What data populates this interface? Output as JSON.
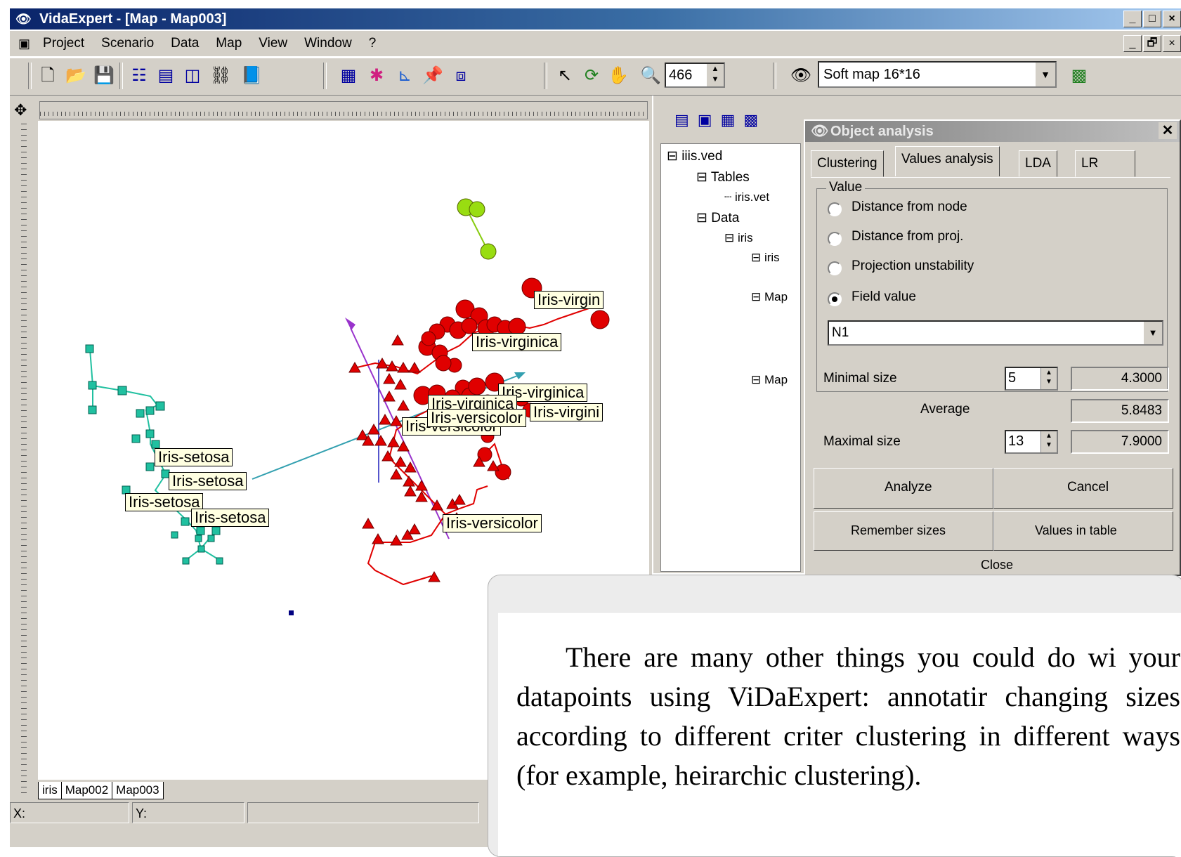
{
  "window": {
    "title": "VidaExpert - [Map - Map003]",
    "buttons": [
      "_",
      "□",
      "×"
    ],
    "mdi_buttons": [
      "_",
      "🗗",
      "×"
    ]
  },
  "menu": [
    "Project",
    "Scenario",
    "Data",
    "Map",
    "View",
    "Window",
    "?"
  ],
  "toolbar": {
    "zoom_value": "466",
    "map_select": "Soft map 16*16"
  },
  "map": {
    "labels": {
      "virg1": "Iris-virgin",
      "virg2": "Iris-virginica",
      "virg3": "Iris-virginica",
      "virg4": "Iris-virginica",
      "virg5": "Iris-virgini",
      "vers1": "Iris-versicolor",
      "vers2": "Iris-versicolor",
      "vers3": "Iris-versicolor",
      "set1": "Iris-setosa",
      "set2": "Iris-setosa",
      "set3": "Iris-setosa",
      "set4": "Iris-setosa"
    },
    "tabs": [
      "iris",
      "Map002",
      "Map003"
    ],
    "status": {
      "x_label": "X:",
      "y_label": "Y:"
    }
  },
  "tree": {
    "root": "iiis.ved",
    "tables": "Tables",
    "table_file": "iris.vet",
    "data": "Data",
    "data_iris": "iris",
    "iris_sub": "iris",
    "map1": "Map",
    "map2": "Map"
  },
  "dialog": {
    "title": "Object analysis",
    "tabs": [
      "Clustering",
      "Values analysis",
      "LDA",
      "LR"
    ],
    "value_group_label": "Value",
    "radios": [
      {
        "label": "Distance from node",
        "selected": false
      },
      {
        "label": "Distance from proj.",
        "selected": false
      },
      {
        "label": "Projection unstability",
        "selected": false
      },
      {
        "label": "Field value",
        "selected": true
      }
    ],
    "field_select": "N1",
    "minimal_size_label": "Minimal size",
    "minimal_size": "5",
    "minimal_value": "4.3000",
    "average_label": "Average",
    "average_value": "5.8483",
    "maximal_size_label": "Maximal size",
    "maximal_size": "13",
    "maximal_value": "7.9000",
    "analyze": "Analyze",
    "cancel": "Cancel",
    "remember_sizes": "Remember sizes",
    "values_in_table": "Values in table",
    "close": "Close"
  },
  "caption": {
    "text": "There are many other things you could do wi your datapoints using ViDaExpert: annotatir changing sizes according to different criter clustering in different ways (for example, heirarchic clustering)."
  },
  "colors": {
    "setosa": "#20c0a0",
    "versicolor_virginica": "#e00000",
    "green_cluster": "#88cc11",
    "axis_purple": "#9933cc",
    "axis_teal": "#33a0b0",
    "axis_blue": "#5555cc"
  }
}
